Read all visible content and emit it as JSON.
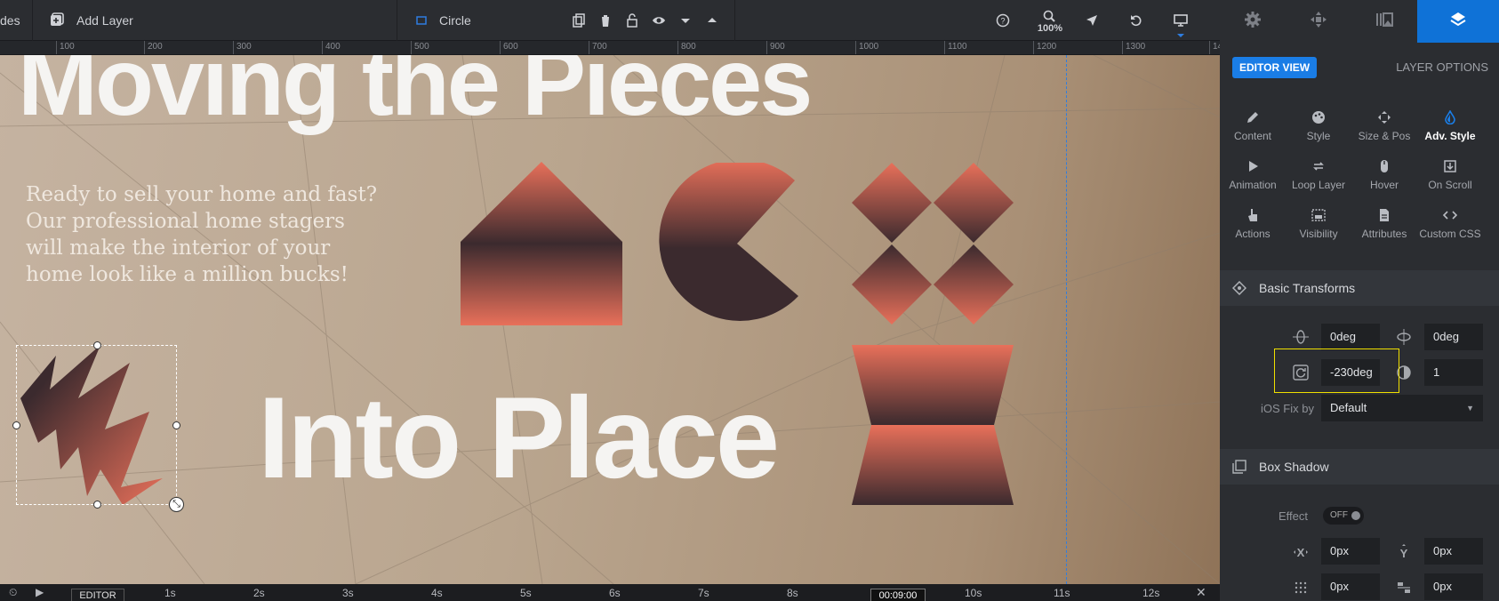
{
  "toolbar": {
    "left_label": "des",
    "add_layer": "Add Layer",
    "layer_name": "Circle",
    "zoom": "100%"
  },
  "ruler": [
    "100",
    "200",
    "300",
    "400",
    "500",
    "600",
    "700",
    "800",
    "900",
    "1000",
    "1100",
    "1200",
    "1300",
    "14"
  ],
  "stage": {
    "headline_top": "Moving the Pieces",
    "headline_bottom": "Into Place",
    "body": "Ready to sell your home and fast? Our professional home stagers will make the interior of your home look like a million bucks!",
    "shape_colors": {
      "coral": "#e8705a",
      "dark": "#3b2a2e"
    }
  },
  "timeline": {
    "editor": "EDITOR",
    "ticks": [
      "1s",
      "2s",
      "3s",
      "4s",
      "5s",
      "6s",
      "7s",
      "8s",
      "10s",
      "11s",
      "12s"
    ],
    "current": "00:09:00"
  },
  "panel": {
    "editor_view": "EDITOR VIEW",
    "layer_options": "LAYER OPTIONS",
    "tabs": [
      {
        "label": "Content",
        "icon": "pencil-icon"
      },
      {
        "label": "Style",
        "icon": "palette-icon"
      },
      {
        "label": "Size & Pos",
        "icon": "move-icon"
      },
      {
        "label": "Adv. Style",
        "icon": "drop-icon"
      },
      {
        "label": "Animation",
        "icon": "play-icon"
      },
      {
        "label": "Loop Layer",
        "icon": "loop-icon"
      },
      {
        "label": "Hover",
        "icon": "mouse-icon"
      },
      {
        "label": "On Scroll",
        "icon": "scroll-icon"
      },
      {
        "label": "Actions",
        "icon": "hand-icon"
      },
      {
        "label": "Visibility",
        "icon": "visibility-icon"
      },
      {
        "label": "Attributes",
        "icon": "file-icon"
      },
      {
        "label": "Custom CSS",
        "icon": "code-icon"
      }
    ],
    "basic_transforms": "Basic Transforms",
    "rot_x": "0deg",
    "rot_y": "0deg",
    "rot_z": "-230deg",
    "opacity": "1",
    "ios_fix_label": "iOS Fix by",
    "ios_fix_value": "Default",
    "box_shadow": "Box Shadow",
    "effect_label": "Effect",
    "effect_value": "OFF",
    "shadow_x": "0px",
    "shadow_y": "0px",
    "shadow_blur": "0px",
    "shadow_spread": "0px"
  },
  "accent": "#0f72d7"
}
